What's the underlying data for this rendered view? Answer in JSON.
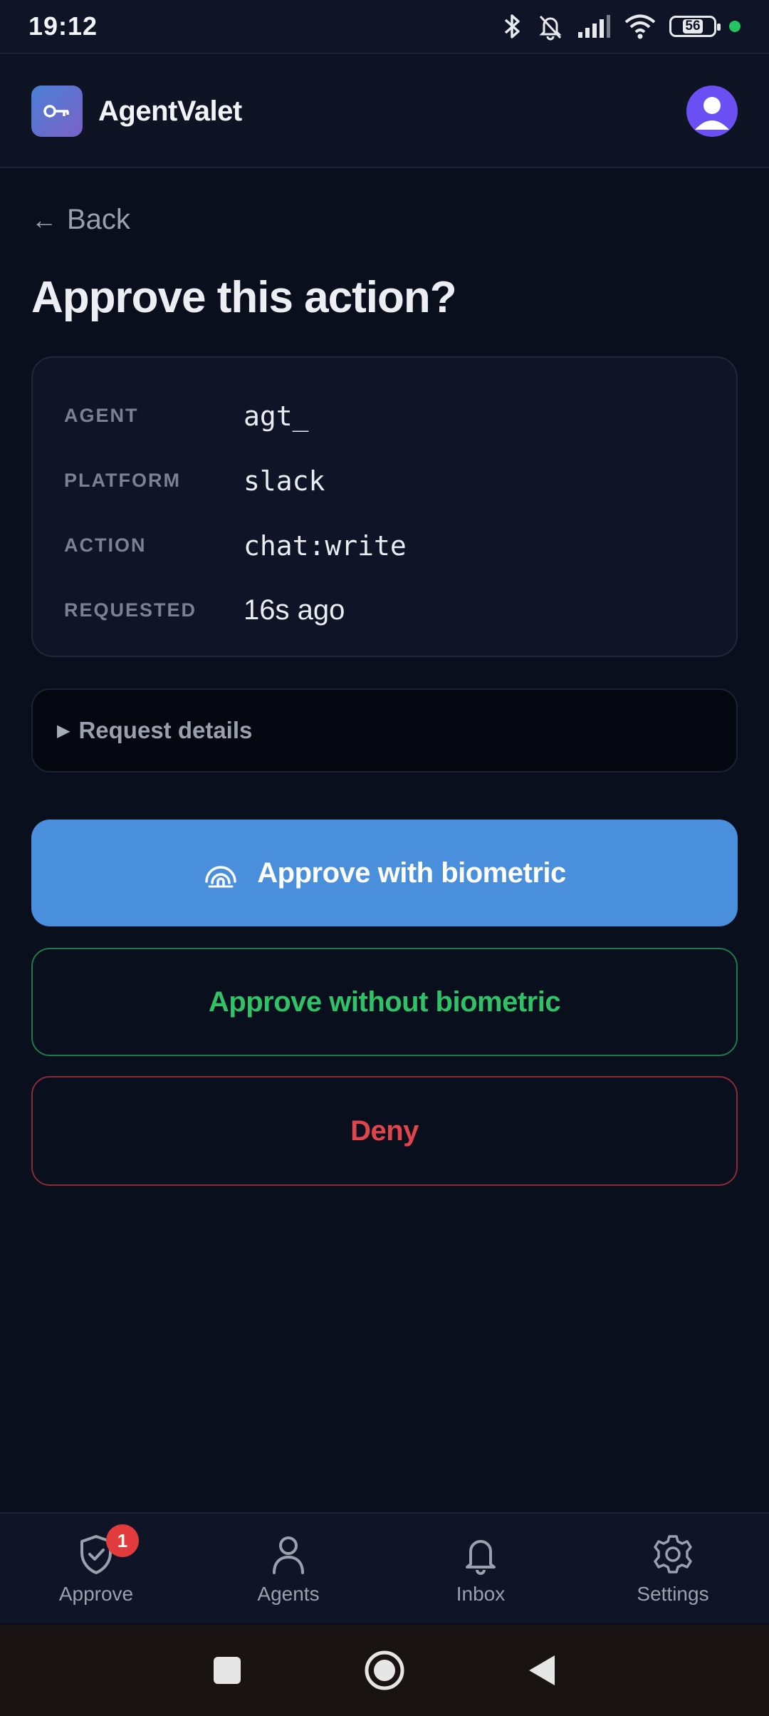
{
  "status_bar": {
    "time": "19:12",
    "battery": "56",
    "icons": [
      "bluetooth-icon",
      "bell-muted-icon",
      "signal-icon",
      "wifi-icon",
      "battery-icon",
      "status-dot"
    ]
  },
  "header": {
    "app_name": "AgentValet",
    "logo_icon": "key-icon",
    "avatar_icon": "user-avatar"
  },
  "nav": {
    "back_arrow": "←",
    "back_label": "Back"
  },
  "page": {
    "title": "Approve this action?"
  },
  "request": {
    "rows": [
      {
        "label": "AGENT",
        "value": "agt_"
      },
      {
        "label": "PLATFORM",
        "value": "slack"
      },
      {
        "label": "ACTION",
        "value": "chat:write"
      },
      {
        "label": "REQUESTED",
        "value": "16s ago"
      }
    ]
  },
  "details": {
    "toggle": "▶",
    "label": "Request details"
  },
  "actions": {
    "approve_biometric": "Approve with biometric",
    "approve_no_biometric": "Approve without biometric",
    "deny": "Deny"
  },
  "colors": {
    "primary": "#4a8fdc",
    "success": "#2fc266",
    "danger": "#e0454b",
    "badge": "#e23b3b"
  },
  "bottom_nav": {
    "items": [
      {
        "label": "Approve",
        "icon": "shield-check-icon",
        "badge": "1"
      },
      {
        "label": "Agents",
        "icon": "person-icon"
      },
      {
        "label": "Inbox",
        "icon": "bell-icon"
      },
      {
        "label": "Settings",
        "icon": "gear-icon"
      }
    ]
  }
}
